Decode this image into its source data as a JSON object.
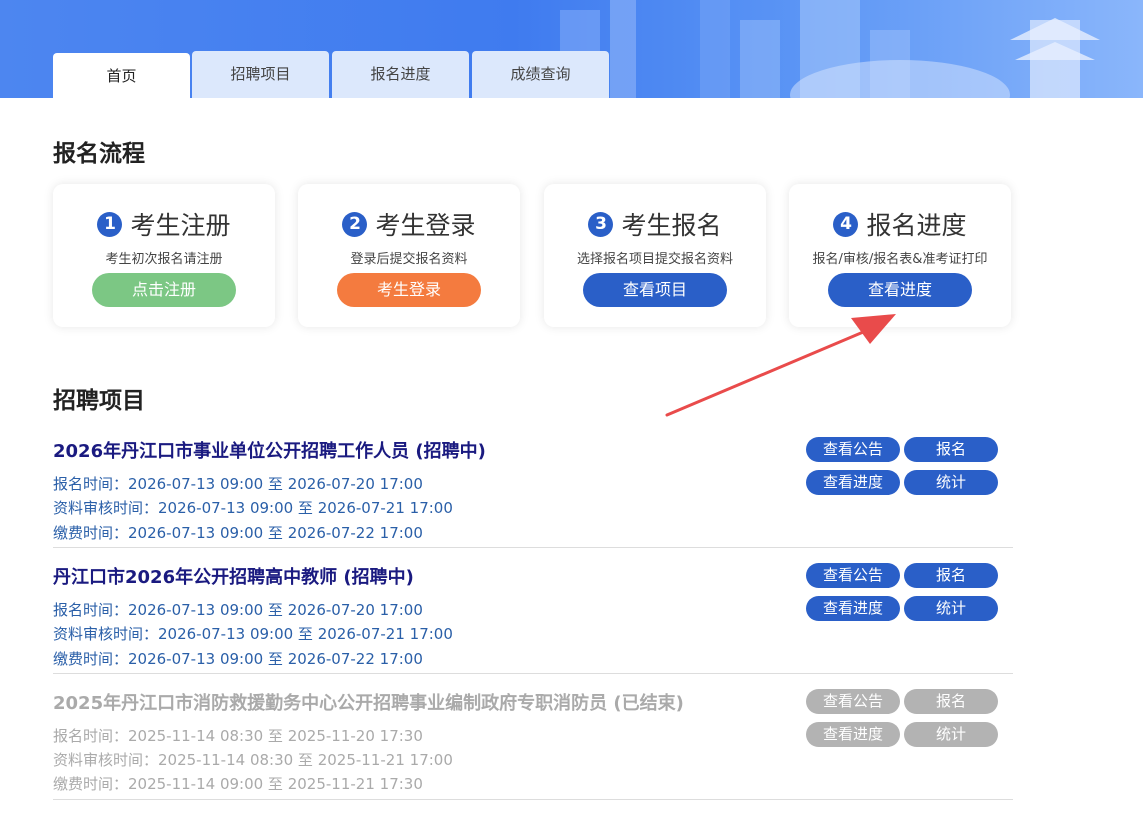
{
  "tabs": [
    {
      "label": "首页"
    },
    {
      "label": "招聘项目"
    },
    {
      "label": "报名进度"
    },
    {
      "label": "成绩查询"
    }
  ],
  "process": {
    "title": "报名流程",
    "steps": [
      {
        "num": "1",
        "title": "考生注册",
        "desc": "考生初次报名请注册",
        "button": "点击注册",
        "color": "#7cc784"
      },
      {
        "num": "2",
        "title": "考生登录",
        "desc": "登录后提交报名资料",
        "button": "考生登录",
        "color": "#f47b3f"
      },
      {
        "num": "3",
        "title": "考生报名",
        "desc": "选择报名项目提交报名资料",
        "button": "查看项目",
        "color": "#2a5fc8"
      },
      {
        "num": "4",
        "title": "报名进度",
        "desc": "报名/审核/报名表&准考证打印",
        "button": "查看进度",
        "color": "#2a5fc8"
      }
    ]
  },
  "projects": {
    "title": "招聘项目",
    "items": [
      {
        "title": "2026年丹江口市事业单位公开招聘工作人员 (招聘中)",
        "lines": [
          "报名时间：2026-07-13 09:00 至 2026-07-20 17:00",
          "资料审核时间：2026-07-13 09:00 至 2026-07-21 17:00",
          "缴费时间：2026-07-13 09:00 至 2026-07-22 17:00"
        ],
        "status": "active",
        "buttons": {
          "notice": "查看公告",
          "apply": "报名",
          "progress": "查看进度",
          "stats": "统计"
        }
      },
      {
        "title": "丹江口市2026年公开招聘高中教师 (招聘中)",
        "lines": [
          "报名时间：2026-07-13 09:00 至 2026-07-20 17:00",
          "资料审核时间：2026-07-13 09:00 至 2026-07-21 17:00",
          "缴费时间：2026-07-13 09:00 至 2026-07-22 17:00"
        ],
        "status": "active",
        "buttons": {
          "notice": "查看公告",
          "apply": "报名",
          "progress": "查看进度",
          "stats": "统计"
        }
      },
      {
        "title": "2025年丹江口市消防救援勤务中心公开招聘事业编制政府专职消防员 (已结束)",
        "lines": [
          "报名时间：2025-11-14 08:30 至 2025-11-20 17:30",
          "资料审核时间：2025-11-14 08:30 至 2025-11-21 17:00",
          "缴费时间：2025-11-14 09:00 至 2025-11-21 17:30"
        ],
        "status": "ended",
        "buttons": {
          "notice": "查看公告",
          "apply": "报名",
          "progress": "查看进度",
          "stats": "统计"
        }
      }
    ]
  },
  "colors": {
    "primary": "#2a5fc8",
    "title_blue": "#1a1a80",
    "line_blue": "#2a5fa8",
    "ended_gray": "#b3b3b3",
    "arrow_red": "#e94b4b"
  }
}
